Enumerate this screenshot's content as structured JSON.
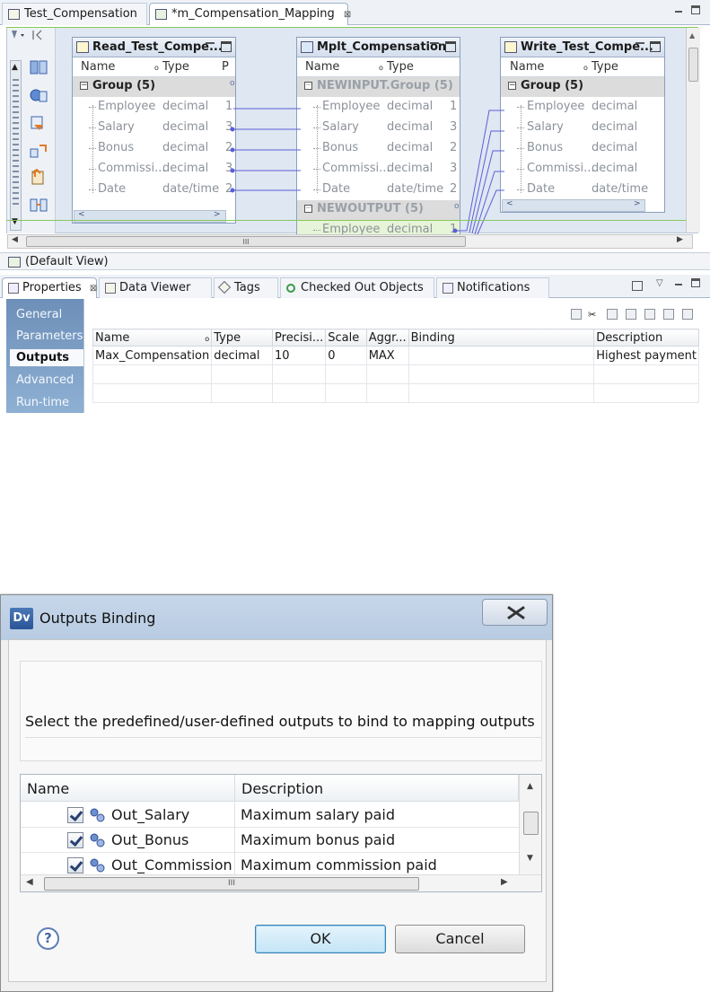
{
  "editor": {
    "tabs": [
      {
        "label": "Test_Compensation",
        "active": false
      },
      {
        "label": "*m_Compensation_Mapping",
        "active": true
      }
    ],
    "close_glyph": "⊠"
  },
  "mapping": {
    "read": {
      "title": "Read_Test_Compe...",
      "col_name": "Name",
      "col_type": "Type",
      "col_p": "P",
      "group": "Group (5)",
      "rows": [
        {
          "name": "Employee",
          "type": "decimal",
          "p": "1"
        },
        {
          "name": "Salary",
          "type": "decimal",
          "p": "3"
        },
        {
          "name": "Bonus",
          "type": "decimal",
          "p": "2"
        },
        {
          "name": "Commissi...",
          "type": "decimal",
          "p": "3"
        },
        {
          "name": "Date",
          "type": "date/time",
          "p": "2"
        }
      ]
    },
    "mplt": {
      "title": "Mplt_Compensation",
      "col_name": "Name",
      "col_type": "Type",
      "in_group": "NEWINPUT.Group (5)",
      "rows": [
        {
          "name": "Employee",
          "type": "decimal",
          "p": "1"
        },
        {
          "name": "Salary",
          "type": "decimal",
          "p": "3"
        },
        {
          "name": "Bonus",
          "type": "decimal",
          "p": "2"
        },
        {
          "name": "Commissi...",
          "type": "decimal",
          "p": "3"
        },
        {
          "name": "Date",
          "type": "date/time",
          "p": "2"
        }
      ],
      "out_group": "NEWOUTPUT (5)",
      "out_row": {
        "name": "Employee",
        "type": "decimal",
        "p": "1"
      }
    },
    "write": {
      "title": "Write_Test_Compe...",
      "col_name": "Name",
      "col_type": "Type",
      "group": "Group (5)",
      "rows": [
        {
          "name": "Employee",
          "type": "decimal"
        },
        {
          "name": "Salary",
          "type": "decimal"
        },
        {
          "name": "Bonus",
          "type": "decimal"
        },
        {
          "name": "Commissi...",
          "type": "decimal"
        },
        {
          "name": "Date",
          "type": "date/time"
        }
      ]
    },
    "scroll_grip": "III"
  },
  "default_view": "(Default View)",
  "properties": {
    "tabs": [
      {
        "label": "Properties",
        "active": true
      },
      {
        "label": "Data Viewer",
        "active": false
      },
      {
        "label": "Tags",
        "active": false
      },
      {
        "label": "Checked Out Objects",
        "active": false
      },
      {
        "label": "Notifications",
        "active": false
      }
    ],
    "sidebar": [
      "General",
      "Parameters",
      "Outputs",
      "Advanced",
      "Run-time"
    ],
    "active_section": "Outputs",
    "columns": [
      "Name",
      "Type",
      "Precisi...",
      "Scale",
      "Aggr...",
      "Binding",
      "Description"
    ],
    "rows": [
      [
        "Max_Compensation",
        "decimal",
        "10",
        "0",
        "MAX",
        "",
        "Highest payment"
      ]
    ]
  },
  "dialog": {
    "app_icon": "Dv",
    "title": "Outputs Binding",
    "message": "Select the predefined/user-defined outputs to bind to mapping outputs",
    "col_name": "Name",
    "col_description": "Description",
    "outputs": [
      {
        "name": "Out_Salary",
        "description": "Maximum salary paid",
        "checked": true
      },
      {
        "name": "Out_Bonus",
        "description": "Maximum bonus paid",
        "checked": true
      },
      {
        "name": "Out_Commission",
        "description": "Maximum commission paid",
        "checked": true
      }
    ],
    "ok_label": "OK",
    "cancel_label": "Cancel",
    "help_glyph": "?",
    "scroll_grip": "III"
  }
}
